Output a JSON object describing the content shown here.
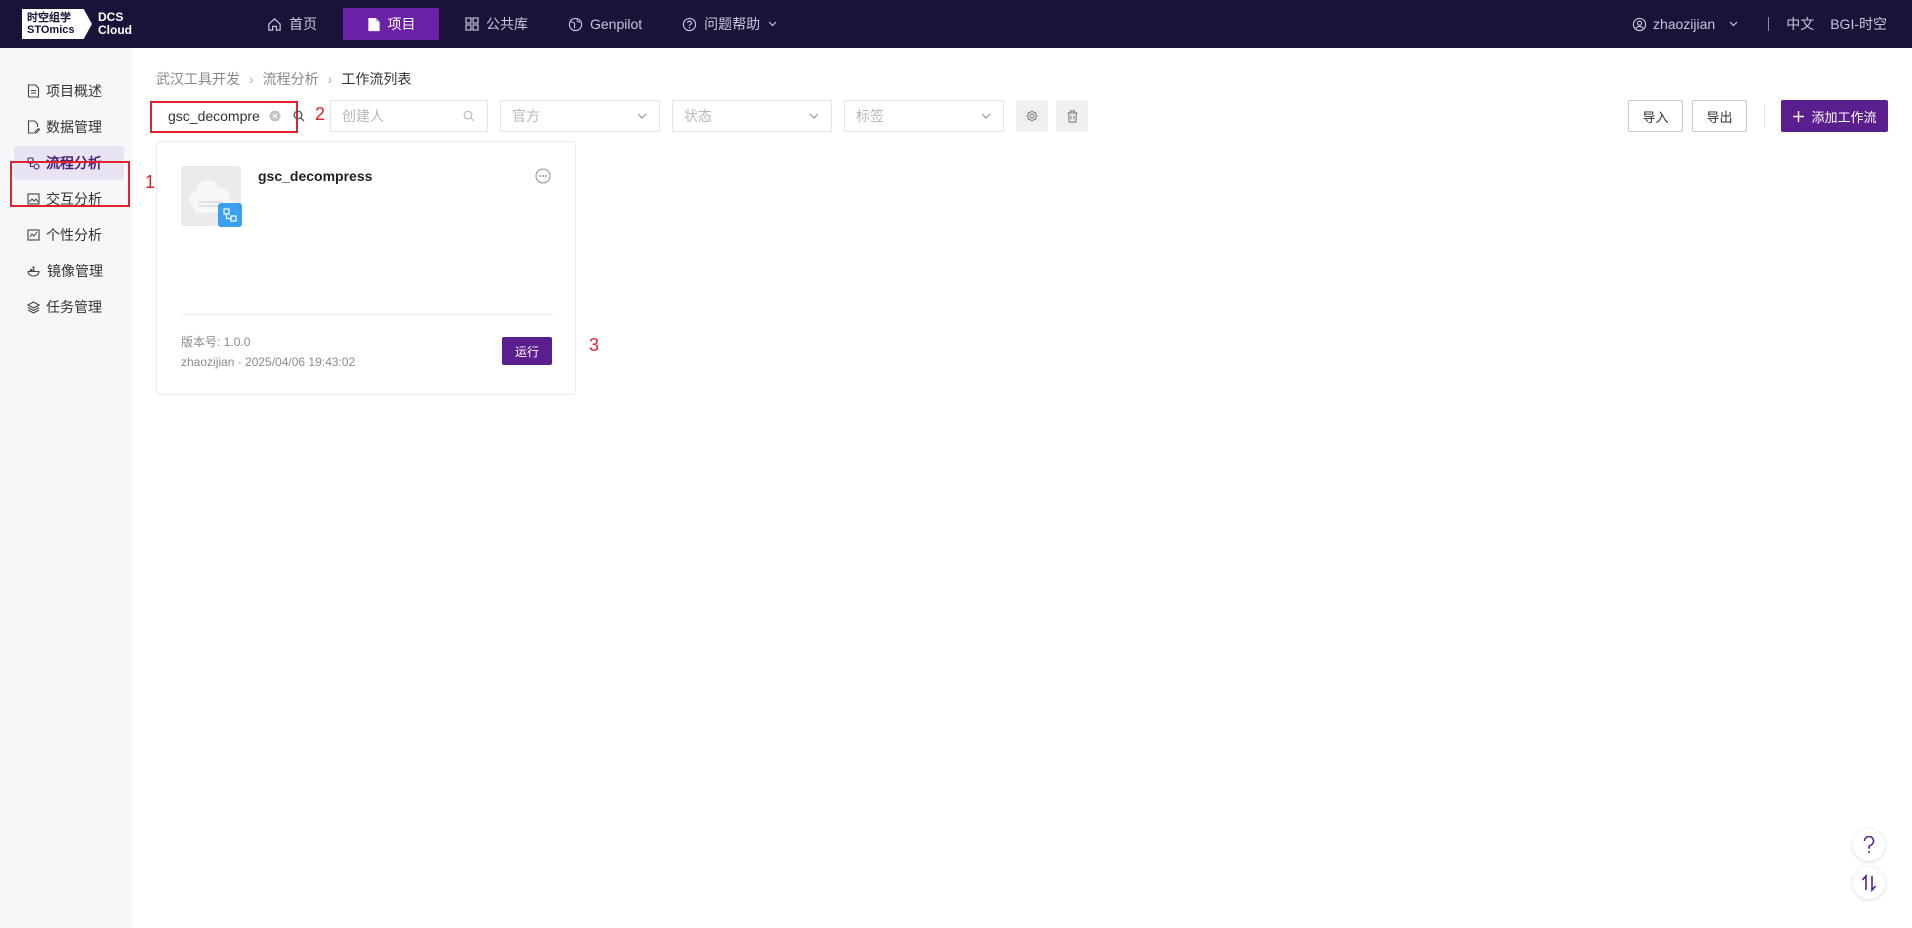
{
  "app": {
    "logo_line1": "时空组学",
    "logo_line2": "STOmics",
    "logo_product_line1": "DCS",
    "logo_product_line2": "Cloud"
  },
  "nav": {
    "items": [
      {
        "label": "首页",
        "icon": "home-icon"
      },
      {
        "label": "项目",
        "icon": "document-icon",
        "active": true
      },
      {
        "label": "公共库",
        "icon": "grid-icon"
      },
      {
        "label": "Genpilot",
        "icon": "globe-icon"
      },
      {
        "label": "问题帮助",
        "icon": "help-circle-icon"
      }
    ]
  },
  "user": {
    "name": "zhaozijian",
    "language": "中文",
    "org": "BGI-时空"
  },
  "sidebar": {
    "items": [
      {
        "label": "项目概述",
        "icon": "file-icon"
      },
      {
        "label": "数据管理",
        "icon": "file-edit-icon"
      },
      {
        "label": "流程分析",
        "icon": "workflow-icon",
        "active": true
      },
      {
        "label": "交互分析",
        "icon": "image-icon"
      },
      {
        "label": "个性分析",
        "icon": "chart-icon"
      },
      {
        "label": "镜像管理",
        "icon": "docker-icon"
      },
      {
        "label": "任务管理",
        "icon": "layers-icon"
      }
    ]
  },
  "breadcrumb": {
    "items": [
      "武汉工具开发",
      "流程分析",
      "工作流列表"
    ]
  },
  "filters": {
    "search_value": "gsc_decompre",
    "creator_placeholder": "创建人",
    "source_placeholder": "官方",
    "status_placeholder": "状态",
    "tag_placeholder": "标签"
  },
  "toolbar": {
    "import_label": "导入",
    "export_label": "导出",
    "add_label": "添加工作流"
  },
  "workflow_card": {
    "title": "gsc_decompress",
    "version_label": "版本号:",
    "version": "1.0.0",
    "meta": "zhaozijian · 2025/04/06 19:43:02",
    "run_label": "运行"
  },
  "annotations": [
    "1",
    "2",
    "3"
  ],
  "colors": {
    "nav_bg": "#1a1238",
    "accent": "#5b1e8f",
    "annotation": "#e0222d",
    "badge": "#3aa0f2"
  }
}
